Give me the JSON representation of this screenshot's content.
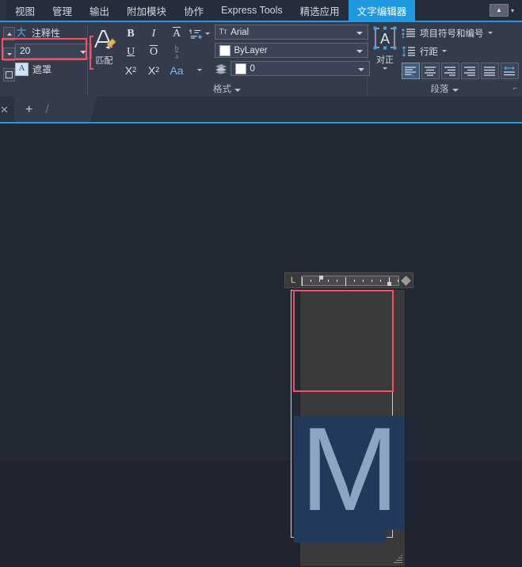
{
  "tabbar": {
    "tabs": [
      {
        "label": "视图",
        "active": false
      },
      {
        "label": "管理",
        "active": false
      },
      {
        "label": "输出",
        "active": false
      },
      {
        "label": "附加模块",
        "active": false
      },
      {
        "label": "协作",
        "active": false
      },
      {
        "label": "Express Tools",
        "active": false
      },
      {
        "label": "精选应用",
        "active": false
      },
      {
        "label": "文字编辑器",
        "active": true
      }
    ],
    "app_chip": "▲",
    "app_chip_caret": "▾",
    "active_color": "#1f9ae0"
  },
  "style_panel": {
    "annotative_label": "注释性",
    "mask_label": "遮罩",
    "mask_icon_letter": "A",
    "text_height_value": "20",
    "text_height_caret": "▾",
    "mini_caret": "▾"
  },
  "format_panel": {
    "title": "格式",
    "title_caret": "▾",
    "match_label": "匹配",
    "bold": "B",
    "italic": "I",
    "strikethrough": "A",
    "stack_caret": "▾",
    "underline": "U",
    "overline": "O",
    "fraction_num": "b",
    "fraction_den": "a",
    "superscript_base": "X",
    "superscript_exp": "2",
    "subscript_base": "X",
    "subscript_idx": "2",
    "case_label": "Aa",
    "case_caret": "▾",
    "font_icon": "Tт",
    "font_value": "Arial",
    "color_value": "ByLayer",
    "layer_value": "0",
    "caret": "▾"
  },
  "paragraph_panel": {
    "title": "段落",
    "title_caret": "▾",
    "justify_label": "对正",
    "justify_letter": "A",
    "justify_caret": "▾",
    "bullets_label": "项目符号和编号",
    "bullets_caret": "▾",
    "linespacing_label": "行距",
    "linespacing_caret": "▾",
    "dialog_launcher": "⌐",
    "align_buttons": [
      {
        "name": "align-left",
        "selected": true
      },
      {
        "name": "align-center",
        "selected": false
      },
      {
        "name": "align-right",
        "selected": false
      },
      {
        "name": "align-justify",
        "selected": false
      },
      {
        "name": "align-distribute",
        "selected": false
      },
      {
        "name": "align-spread",
        "selected": false
      }
    ]
  },
  "docstrip": {
    "close": "✕",
    "plus": "+",
    "slash": "/"
  },
  "editor": {
    "ruler_corner_icon": "L",
    "text_content": "M",
    "font_preview": "Arial",
    "size_preview": "20"
  },
  "colors": {
    "accent": "#1f9ae0",
    "ribbon_bg": "#343c4c",
    "tabbar_bg": "#262c3a",
    "canvas_bg": "#222834",
    "annotation_red": "#ff4d5e",
    "selection_blue": "#23395c",
    "glyph_blue": "#8ca5c2"
  }
}
